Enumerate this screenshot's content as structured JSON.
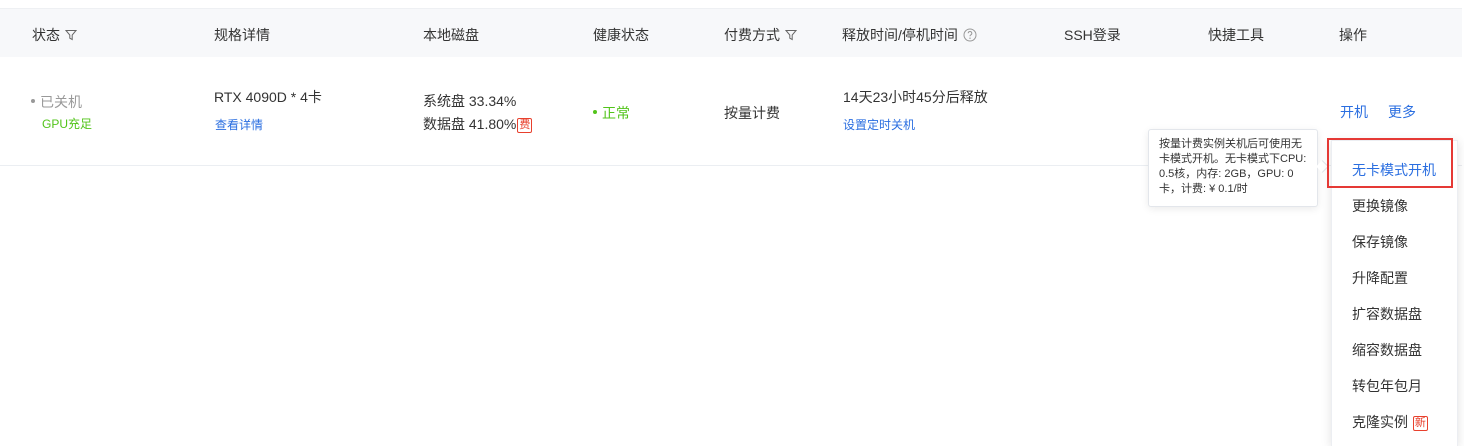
{
  "header": {
    "status": "状态",
    "spec": "规格详情",
    "disk": "本地磁盘",
    "health": "健康状态",
    "billing": "付费方式",
    "release": "释放时间/停机时间",
    "ssh": "SSH登录",
    "tools": "快捷工具",
    "actions": "操作"
  },
  "row": {
    "status": "已关机",
    "gpu_status": "GPU充足",
    "spec": "RTX 4090D * 4卡",
    "spec_link": "查看详情",
    "sys_disk": "系统盘 33.34%",
    "data_disk": "数据盘 41.80%",
    "fee_badge": "费",
    "health": "正常",
    "billing": "按量计费",
    "release": "14天23小时45分后释放",
    "schedule_link": "设置定时关机",
    "action_start": "开机",
    "action_more": "更多"
  },
  "tooltip": {
    "text": "按量计费实例关机后可使用无卡模式开机。无卡模式下CPU: 0.5核，内存: 2GB，GPU: 0卡，计费: ¥ 0.1/时"
  },
  "menu": {
    "items": [
      "无卡模式开机",
      "更换镜像",
      "保存镜像",
      "升降配置",
      "扩容数据盘",
      "缩容数据盘",
      "转包年包月",
      "克隆实例"
    ],
    "new_badge": "新"
  },
  "colors": {
    "link": "#2a6ee0",
    "success": "#52c41a",
    "muted": "#999999",
    "danger": "#e8402d",
    "highlight": "#e53935"
  }
}
